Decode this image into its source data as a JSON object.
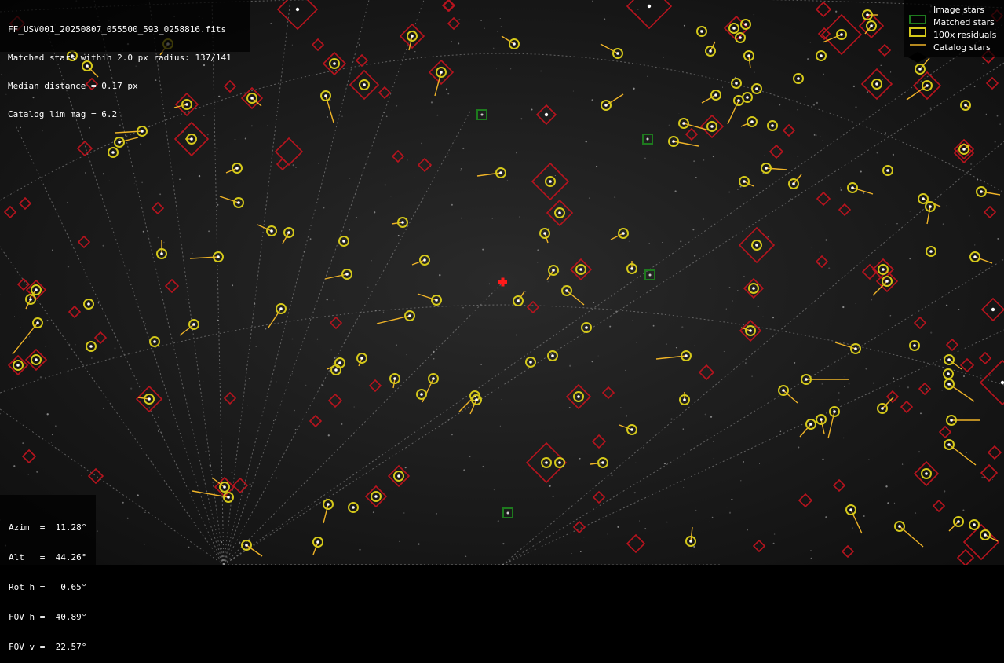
{
  "header": {
    "filename": "FF_USV001_20250807_055500_593_0258816.fits",
    "matched": "Matched stars within 2.0 px radius: 137/141",
    "median": "Median distance = 0.17 px",
    "limmag": "Catalog lim mag = 6.2"
  },
  "legend": {
    "image_stars": "Image stars",
    "matched_stars": "Matched stars",
    "residuals": "100x residuals",
    "catalog_stars": "Catalog stars"
  },
  "params": {
    "azim": "Azim  =  11.28°",
    "alt": "Alt   =  44.26°",
    "roth": "Rot h =   0.65°",
    "fovh": "FOV h =  40.89°",
    "fovv": "FOV v =  22.57°"
  },
  "colors": {
    "image_star": "#1e7a1e",
    "matched_star": "#d4c81a",
    "residual": "#f0b428",
    "catalog_star": "#b8141e",
    "center_mark": "#ff1a1a",
    "grid": "#9a9a9a"
  },
  "icons": {
    "center": "red-cross-icon"
  }
}
